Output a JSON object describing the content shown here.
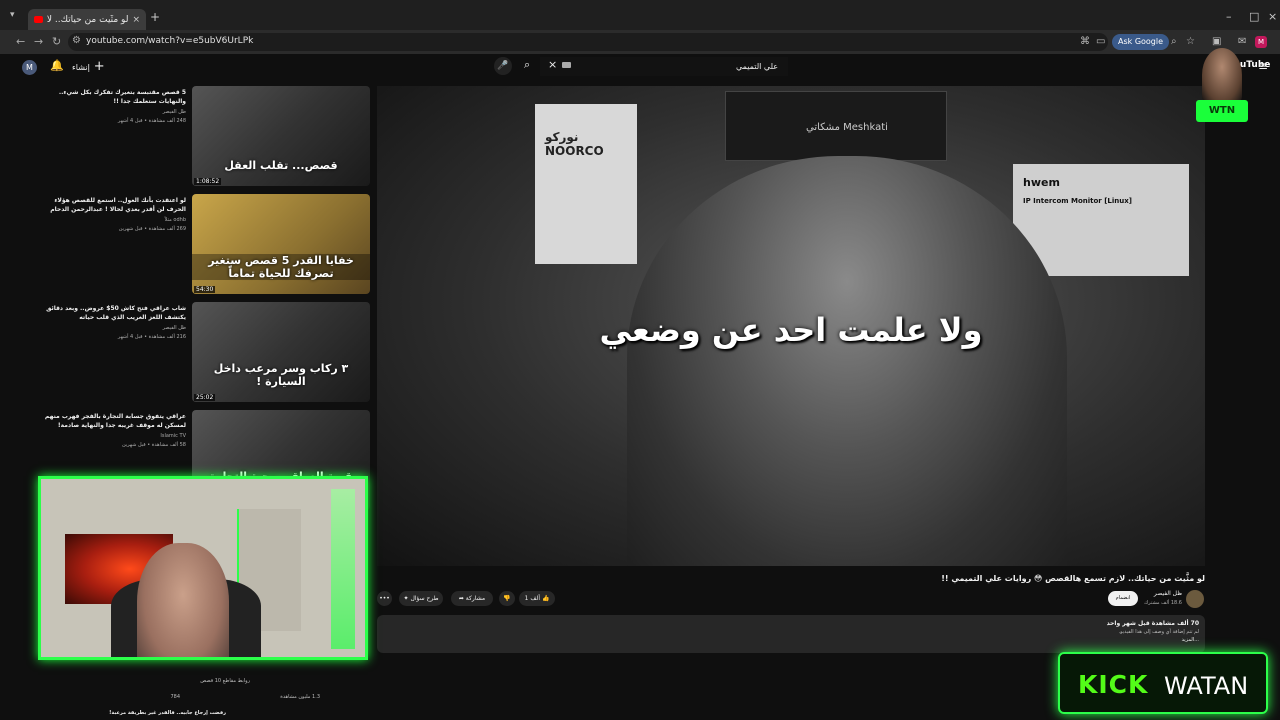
{
  "browser": {
    "tab_title": "لو مثَّيت من حياتك.. لازم تسم",
    "url": "youtube.com/watch?v=e5ubV6UrLPk",
    "ask_google": "Ask Google",
    "profile_initial": "M",
    "tab_close": "×",
    "new_tab": "+"
  },
  "youtube": {
    "account_initial": "M",
    "create_label": "إنشاء",
    "search_value": "علي التميمي",
    "logo_text": "YouTube"
  },
  "video": {
    "subtitle": "ولا علمت احد عن وضعي",
    "title": "لو مثَّيت من حياتك.. لازم تسمع هالقصص 😳 روايات علي التميمي !!",
    "channel_name": "ظل الفيصر",
    "channel_subs": "18.6 ألف مشترك",
    "join_label": "انضمام",
    "like_count": "1 ألف",
    "share_label": "مشاركة",
    "ask_label": "طرح سؤال",
    "more_label": "•••",
    "banner_text": "مشكاتي Meshkati",
    "noorco_text": "نوركو NOORCO",
    "huem_brand": "hwem",
    "huem_product": "IP Intercom Monitor [Linux]"
  },
  "description": {
    "views_time": "70 ألف مشاهدة قبل شهر واحد",
    "line2": "لم تتم إضافة أي وصف إلى هذا الفيديو.",
    "more": "...المزيد"
  },
  "recommendations": [
    {
      "title": "5 قصص مقتبسة بتغيرك تفكرك بكل شيء.. والنهايات ستعلمك جدا !!",
      "channel": "ظل الفيصر",
      "meta": "248 ألف مشاهدة • قبل 4 أشهر",
      "caption": "قصص... تقلب العقل",
      "duration": "1:08:52"
    },
    {
      "title": "لو اعتقدت بأنك الغول.. استمع للقصص هؤلاء الحرف لن أقدر بعدي لحالا ! عبدالرحمن الدحام",
      "channel": "odhb مثلاً",
      "meta": "269 ألف مشاهدة • قبل شهرين",
      "caption": "خفايا القدر 5 قصص ستغير تصرفك للحياة تماماً",
      "duration": "54:30"
    },
    {
      "title": "شاب عراقي فتح كاش 50$ عروض.. وبعد دقائق يكتشف اللغز الغريب الذي قلب حياته",
      "channel": "ظل الفيصر",
      "meta": "216 ألف مشاهدة • قبل 4 أشهر",
      "caption": "٣ ركاب وسر مرعب داخل السيارة !",
      "duration": "25:02"
    },
    {
      "title": "عراقي يتفوق جسابة التجارة بالفجر فهرب منهم لمسكن له موقف غريبه جدا والنهاية صادمة!",
      "channel": "Islamic TV",
      "meta": "58 ألف مشاهدة • قبل شهرين",
      "caption": "قصة العراقي وحبة التجارة بالشيء",
      "duration": ""
    }
  ],
  "under_cam": {
    "a": "روابط مقاطع 10 قصص",
    "b": "1.3 مليون مشاهدة",
    "c": "784",
    "d": "رفضت إرجاع جابيه.. فالقدر غير بطريقة مرعبة!"
  },
  "overlay": {
    "kick": "KICK",
    "watan": "WATAN",
    "logo_w": "WTN"
  }
}
